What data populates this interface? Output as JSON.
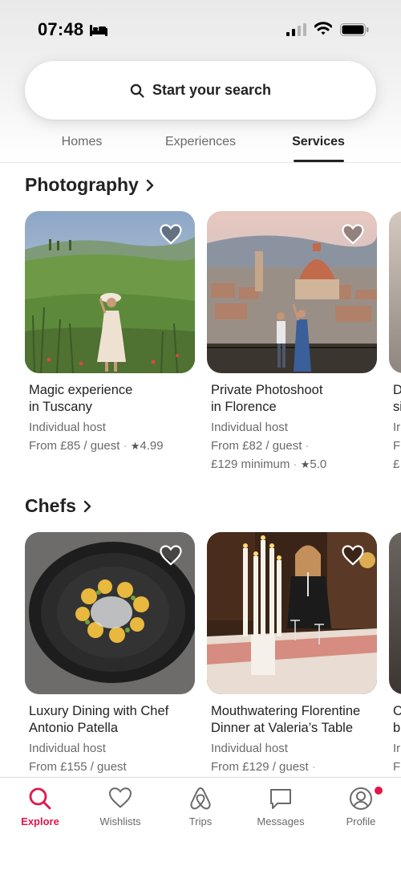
{
  "status_bar": {
    "time": "07:48"
  },
  "search": {
    "label": "Start your search"
  },
  "tabs": [
    {
      "label": "Homes"
    },
    {
      "label": "Experiences"
    },
    {
      "label": "Services",
      "active": true
    }
  ],
  "sections": [
    {
      "title": "Photography",
      "cards": [
        {
          "title_line1": "Magic experience",
          "title_line2": "in Tuscany",
          "host": "Individual host",
          "price": "From £85 / guest",
          "rating": "4.99"
        },
        {
          "title_line1": "Private Photoshoot",
          "title_line2": "in Florence",
          "host": "Individual host",
          "price": "From £82 / guest",
          "minimum": "£129 minimum",
          "rating": "5.0"
        }
      ],
      "peek": {
        "title_initial": "D",
        "title_initial2": "si",
        "host_initial": "Ir",
        "price_initial": "F",
        "min_initial": "£"
      }
    },
    {
      "title": "Chefs",
      "cards": [
        {
          "title_line1": "Luxury Dining with Chef",
          "title_line2": "Antonio Patella",
          "host": "Individual host",
          "price": "From £155 / guest"
        },
        {
          "title_line1": "Mouthwatering Florentine",
          "title_line2": "Dinner at Valeria’s Table",
          "host": "Individual host",
          "price": "From £129 / guest"
        }
      ],
      "peek": {
        "title_initial": "C",
        "title_initial2": "b",
        "host_initial": "Ir",
        "price_initial": "F"
      }
    }
  ],
  "bottom_nav": [
    {
      "label": "Explore",
      "icon": "search-icon",
      "active": true
    },
    {
      "label": "Wishlists",
      "icon": "heart-icon"
    },
    {
      "label": "Trips",
      "icon": "airbnb-logo-icon"
    },
    {
      "label": "Messages",
      "icon": "message-icon"
    },
    {
      "label": "Profile",
      "icon": "profile-icon",
      "has_notification": true
    }
  ],
  "colors": {
    "accent": "#e0174a",
    "text": "#222222",
    "muted": "#6a6a6a"
  }
}
